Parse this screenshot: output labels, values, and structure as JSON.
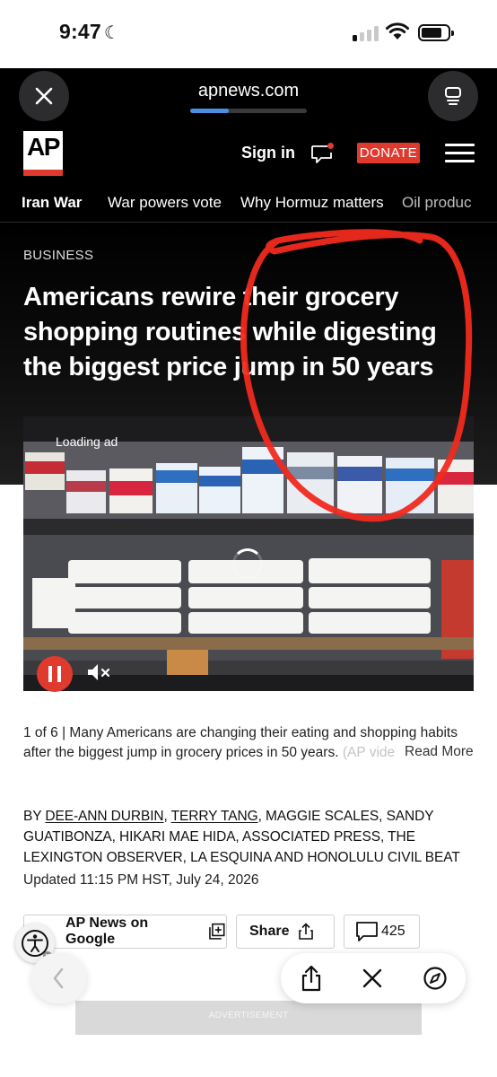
{
  "status_bar": {
    "time": "9:47",
    "moon_icon": "moon-icon",
    "signal_bars_active": 1,
    "signal_bars_total": 4
  },
  "browser": {
    "domain": "apnews.com",
    "load_progress": 0.33,
    "close_icon": "close-icon",
    "tabs_icon": "tabs-icon"
  },
  "header": {
    "logo": "AP",
    "sign_in": "Sign in",
    "donate": "DONATE",
    "chat_icon": "chat-bubble-icon",
    "menu_icon": "hamburger-menu-icon"
  },
  "topics": [
    "Iran War",
    "War powers vote",
    "Why Hormuz matters",
    "Oil produc"
  ],
  "article": {
    "section": "BUSINESS",
    "headline": "Americans rewire their grocery shopping routines while digesting the biggest price jump in 50 years",
    "media": {
      "loading_label": "Loading ad",
      "pause_icon": "pause-icon",
      "mute_icon": "mute-icon"
    },
    "caption_counter": "1 of 6",
    "caption_text": "Many Americans are changing their eating and shopping habits after the biggest jump in grocery prices in 50 years.",
    "caption_fade": "(AP vide",
    "read_more": "Read More",
    "byline": {
      "by": "BY",
      "author_1": "DEE-ANN DURBIN",
      "author_2": "TERRY TANG",
      "rest": ", MAGGIE SCALES, SANDY GUATIBONZA, HIKARI MAE HIDA, ASSOCIATED PRESS, THE LEXINGTON OBSERVER, LA ESQUINA AND HONOLULU CIVIL BEAT"
    },
    "updated": "Updated 11:15 PM HST, July 24, 2026"
  },
  "actions": {
    "google": "AP News on Google",
    "share": "Share",
    "comments_count": "425"
  },
  "bottom_toolbar": {
    "back_icon": "chevron-left-icon",
    "share_icon": "share-icon",
    "close_icon": "close-icon",
    "compass_icon": "compass-icon"
  },
  "ad": {
    "label": "ADVERTISEMENT"
  },
  "colors": {
    "ap_red": "#e03a2f",
    "annotation_red": "#f02a1e",
    "progress_blue": "#4a90e2"
  }
}
